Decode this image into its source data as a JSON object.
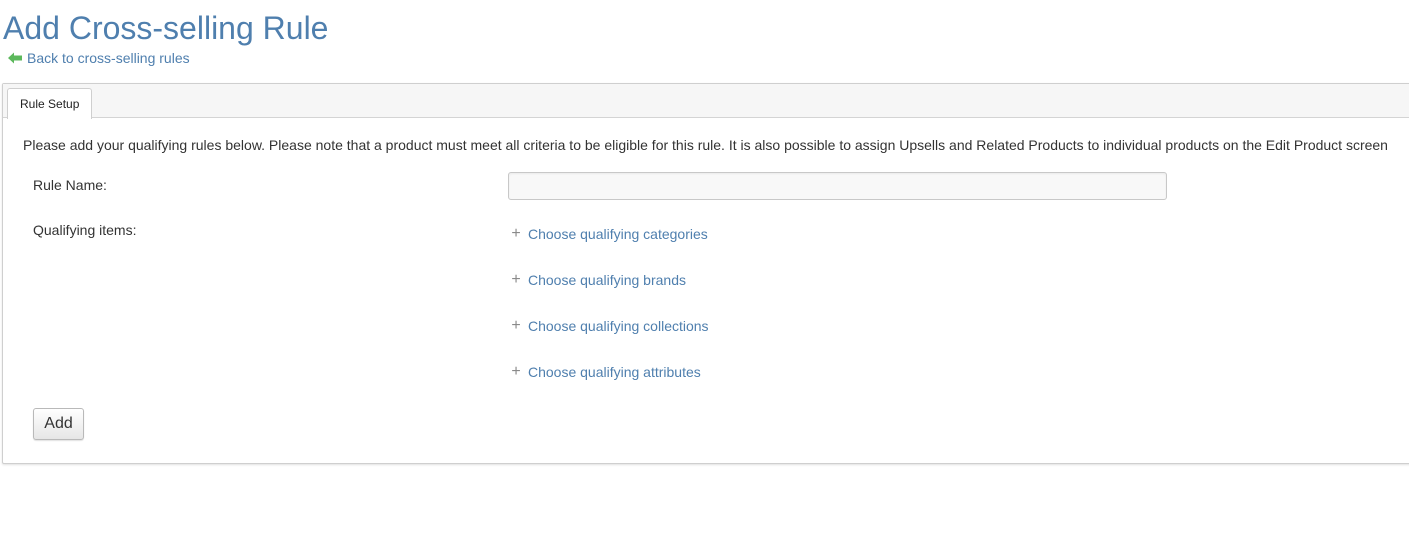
{
  "header": {
    "title": "Add Cross-selling Rule",
    "back_link_label": "Back to cross-selling rules",
    "back_icon": "back-arrow-icon"
  },
  "tabs": [
    {
      "label": "Rule Setup",
      "active": true
    }
  ],
  "form": {
    "intro_text": "Please add your qualifying rules below. Please note that a product must meet all criteria to be eligible for this rule. It is also possible to assign Upsells and Related Products to individual products on the Edit Product screen",
    "rule_name_label": "Rule Name:",
    "rule_name_value": "",
    "qualifying_items_label": "Qualifying items:",
    "choose_links": [
      {
        "label": "Choose qualifying categories",
        "icon": "plus-icon"
      },
      {
        "label": "Choose qualifying brands",
        "icon": "plus-icon"
      },
      {
        "label": "Choose qualifying collections",
        "icon": "plus-icon"
      },
      {
        "label": "Choose qualifying attributes",
        "icon": "plus-icon"
      }
    ],
    "add_button_label": "Add"
  },
  "colors": {
    "link": "#4f7fae",
    "back_arrow": "#5cb85c"
  }
}
